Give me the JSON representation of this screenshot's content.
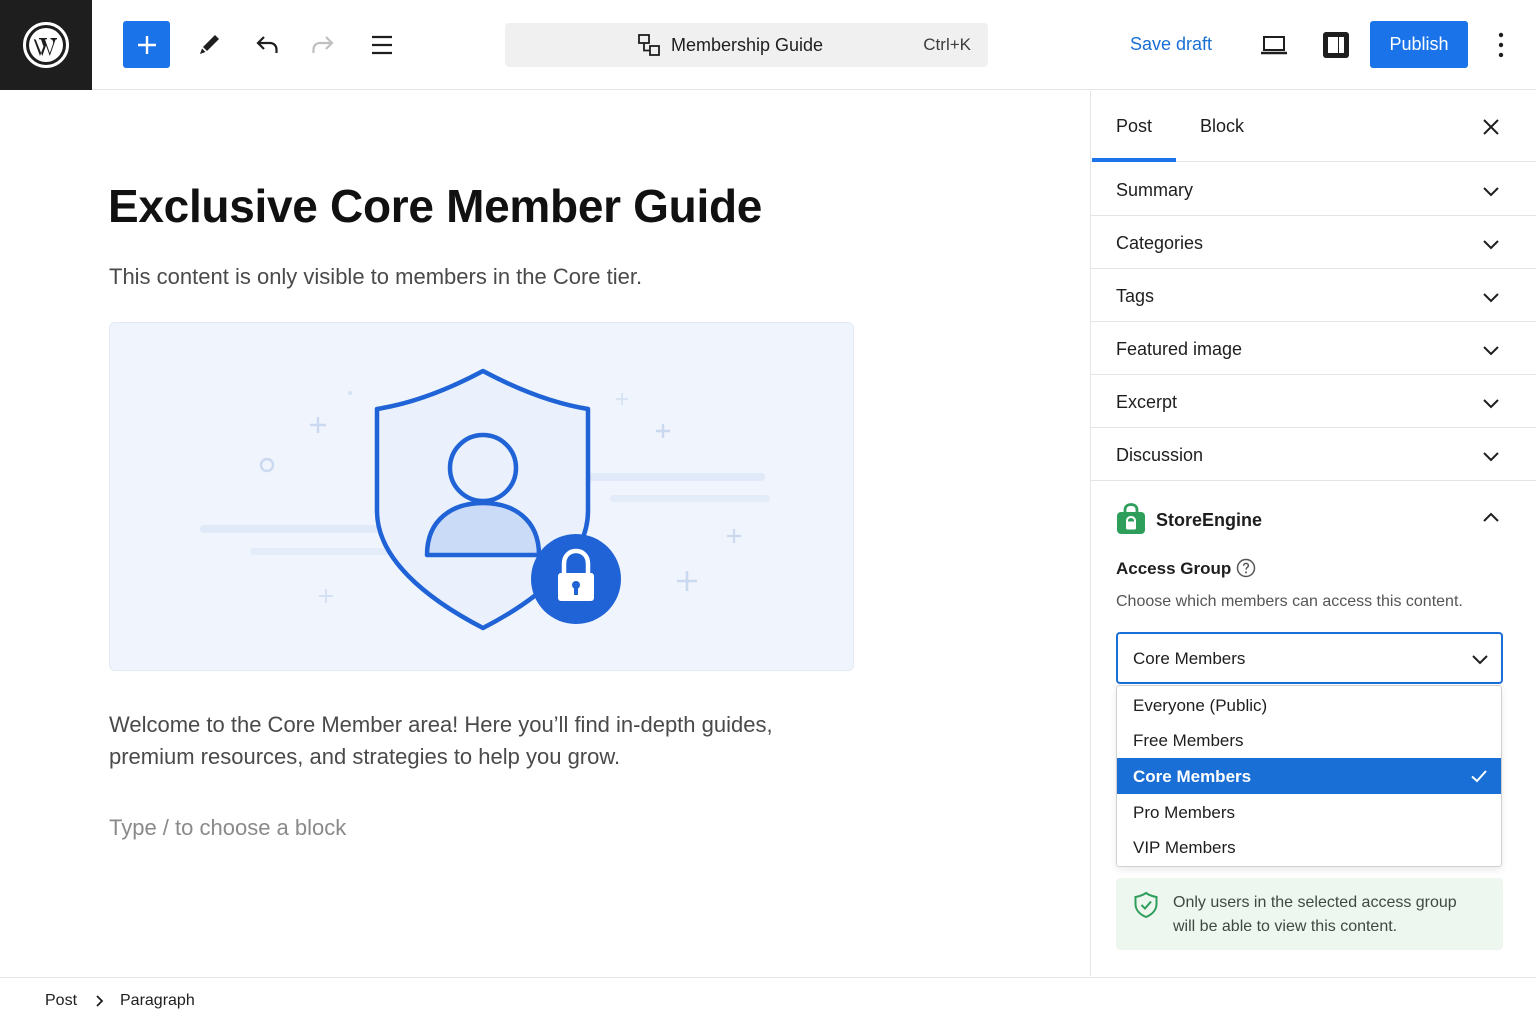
{
  "header": {
    "add_label": "Add block",
    "command_title": "Membership Guide",
    "command_shortcut": "Ctrl+K",
    "save_draft": "Save draft",
    "publish": "Publish"
  },
  "editor": {
    "title": "Exclusive Core Member Guide",
    "intro": "This content is only visible to members in the Core tier.",
    "body": "Welcome to the Core Member area! Here you’ll find in-depth guides, premium resources, and strategies to help you grow.",
    "placeholder": "Type / to choose a block"
  },
  "sidebar": {
    "tabs": [
      {
        "label": "Post",
        "active": true
      },
      {
        "label": "Block",
        "active": false
      }
    ],
    "panels": [
      {
        "label": "Summary"
      },
      {
        "label": "Categories"
      },
      {
        "label": "Tags"
      },
      {
        "label": "Featured image"
      },
      {
        "label": "Excerpt"
      },
      {
        "label": "Discussion"
      }
    ],
    "storeengine": {
      "title": "StoreEngine",
      "access_group_label": "Access Group",
      "access_group_desc": "Choose which members can access this content.",
      "selected_value": "Core Members",
      "options": [
        {
          "label": "Everyone (Public)",
          "selected": false
        },
        {
          "label": "Free Members",
          "selected": false
        },
        {
          "label": "Core Members",
          "selected": true
        },
        {
          "label": "Pro Members",
          "selected": false
        },
        {
          "label": "VIP Members",
          "selected": false
        }
      ],
      "notice": "Only users in the selected access group will be able to view this content."
    }
  },
  "footer": {
    "breadcrumbs": [
      "Post",
      "Paragraph"
    ]
  },
  "colors": {
    "accent": "#1a73e8",
    "storeengine_green": "#2e9e5b",
    "notice_bg": "#eef6f0"
  },
  "icons": [
    "wordpress-logo",
    "plus-icon",
    "pen-icon",
    "undo-icon",
    "redo-icon",
    "list-view-icon",
    "command-icon",
    "desktop-preview-icon",
    "settings-panel-icon",
    "more-vertical-icon",
    "close-icon",
    "chevron-down-icon",
    "chevron-up-icon",
    "storeengine-bag-icon",
    "help-icon",
    "check-icon",
    "shield-check-icon",
    "chevron-right-icon"
  ]
}
